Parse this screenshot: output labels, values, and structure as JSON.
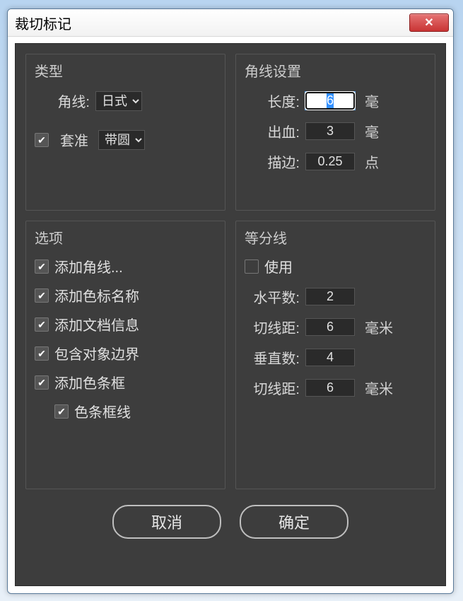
{
  "window": {
    "title": "裁切标记"
  },
  "type": {
    "heading": "类型",
    "corner_label": "角线:",
    "corner_value": "日式",
    "reg_checked": true,
    "reg_label": "套准",
    "reg_value": "带圆"
  },
  "corner_settings": {
    "heading": "角线设置",
    "length_label": "长度:",
    "length_value": "6",
    "length_unit": "毫",
    "bleed_label": "出血:",
    "bleed_value": "3",
    "bleed_unit": "毫",
    "stroke_label": "描边:",
    "stroke_value": "0.25",
    "stroke_unit": "点"
  },
  "options": {
    "heading": "选项",
    "items": [
      {
        "label": "添加角线...",
        "checked": true,
        "indent": false
      },
      {
        "label": "添加色标名称",
        "checked": true,
        "indent": false
      },
      {
        "label": "添加文档信息",
        "checked": true,
        "indent": false
      },
      {
        "label": "包含对象边界",
        "checked": true,
        "indent": false
      },
      {
        "label": "添加色条框",
        "checked": true,
        "indent": false
      },
      {
        "label": "色条框线",
        "checked": true,
        "indent": true
      }
    ]
  },
  "divisions": {
    "heading": "等分线",
    "use_label": "使用",
    "use_checked": false,
    "h_count_label": "水平数:",
    "h_count_value": "2",
    "h_cut_label": "切线距:",
    "h_cut_value": "6",
    "h_cut_unit": "毫米",
    "v_count_label": "垂直数:",
    "v_count_value": "4",
    "v_cut_label": "切线距:",
    "v_cut_value": "6",
    "v_cut_unit": "毫米"
  },
  "buttons": {
    "cancel": "取消",
    "ok": "确定"
  }
}
